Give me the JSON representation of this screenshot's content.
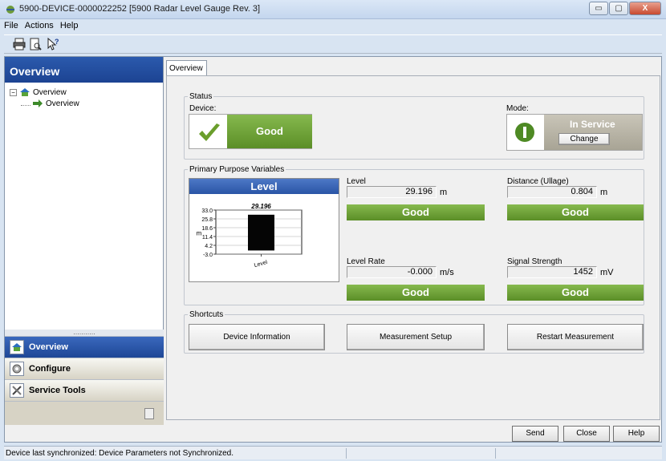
{
  "window": {
    "title": "5900-DEVICE-0000022252 [5900 Radar Level Gauge Rev. 3]",
    "minimize": "▭",
    "maximize": "▢",
    "close": "X"
  },
  "menu": {
    "items": [
      "File",
      "Actions",
      "Help"
    ]
  },
  "toolbar": {
    "icons": [
      "printer-icon",
      "print-preview-icon",
      "context-help-icon"
    ]
  },
  "left_pane": {
    "header": "Overview",
    "tree": {
      "root": "Overview",
      "child": "Overview"
    },
    "nav": [
      {
        "label": "Overview",
        "icon": "home-icon",
        "active": true
      },
      {
        "label": "Configure",
        "icon": "settings-icon",
        "active": false
      },
      {
        "label": "Service Tools",
        "icon": "tools-icon",
        "active": false
      }
    ],
    "grip": "..........."
  },
  "tab": {
    "label": "Overview"
  },
  "status_group": {
    "legend": "Status",
    "device_label": "Device:",
    "device_status": "Good",
    "mode_label": "Mode:",
    "mode_value": "In Service",
    "change_button": "Change"
  },
  "ppv_group": {
    "legend": "Primary Purpose Variables",
    "level_panel_title": "Level",
    "variables": [
      {
        "name": "Level",
        "value": "29.196",
        "unit": "m",
        "status": "Good"
      },
      {
        "name": "Distance (Ullage)",
        "value": "0.804",
        "unit": "m",
        "status": "Good"
      },
      {
        "name": "Level Rate",
        "value": "-0.000",
        "unit": "m/s",
        "status": "Good"
      },
      {
        "name": "Signal Strength",
        "value": "1452",
        "unit": "mV",
        "status": "Good"
      }
    ]
  },
  "chart_data": {
    "type": "bar",
    "categories": [
      "Level"
    ],
    "values": [
      29.196
    ],
    "data_label": "29.196",
    "ylabel": "m",
    "yticks": [
      "33.0",
      "25.8",
      "18.6",
      "11.4",
      "4.2",
      "-3.0"
    ],
    "ylim": [
      -3.0,
      33.0
    ],
    "grid": true
  },
  "shortcuts": {
    "legend": "Shortcuts",
    "buttons": [
      "Device Information",
      "Measurement Setup",
      "Restart Measurement"
    ]
  },
  "bottom_buttons": {
    "send": "Send",
    "close": "Close",
    "help": "Help"
  },
  "statusbar": {
    "text": "Device last synchronized: Device Parameters not Synchronized."
  },
  "colors": {
    "good": "#6b9e35",
    "nav_active": "#2a55a6",
    "header": "#1c4392"
  }
}
